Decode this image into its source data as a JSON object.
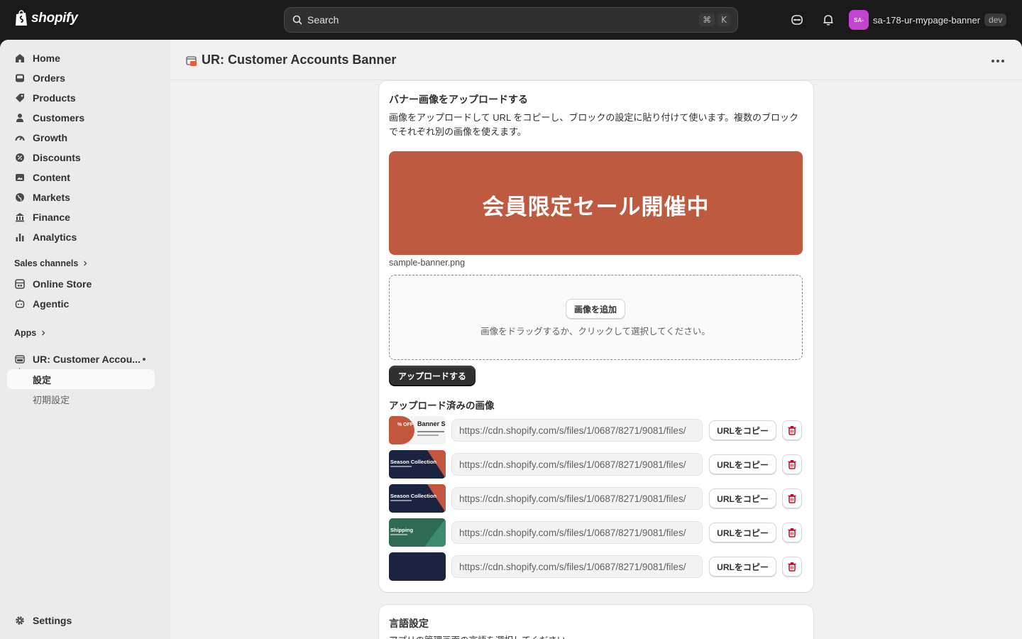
{
  "topbar": {
    "logo_text": "shopify",
    "search_placeholder": "Search",
    "search_shortcut_key1": "⌘",
    "search_shortcut_key2": "K",
    "store_initials": "SA-",
    "store_name": "sa-178-ur-mypage-banner",
    "store_badge": "dev"
  },
  "sidebar": {
    "nav": [
      {
        "label": "Home",
        "icon": "home-icon"
      },
      {
        "label": "Orders",
        "icon": "orders-icon"
      },
      {
        "label": "Products",
        "icon": "tag-icon"
      },
      {
        "label": "Customers",
        "icon": "person-icon"
      },
      {
        "label": "Growth",
        "icon": "gauge-icon"
      },
      {
        "label": "Discounts",
        "icon": "discount-icon"
      },
      {
        "label": "Content",
        "icon": "image-icon"
      },
      {
        "label": "Markets",
        "icon": "globe-icon"
      },
      {
        "label": "Finance",
        "icon": "bank-icon"
      },
      {
        "label": "Analytics",
        "icon": "bar-chart-icon"
      }
    ],
    "sales_channels_label": "Sales channels",
    "channels": [
      {
        "label": "Online Store",
        "icon": "store-icon"
      },
      {
        "label": "Agentic",
        "icon": "agentic-icon"
      }
    ],
    "apps_label": "Apps",
    "app_name": "UR: Customer Accou...",
    "app_sub_active": "設定",
    "app_sub_other": "初期設定",
    "settings_label": "Settings"
  },
  "page": {
    "title": "UR: Customer Accounts Banner"
  },
  "upload_card": {
    "title": "バナー画像をアップロードする",
    "description": "画像をアップロードして URL をコピーし、ブロックの設定に貼り付けて使います。複数のブロックでそれぞれ別の画像を使えます。",
    "banner_text": "会員限定セール開催中",
    "banner_color": "#bd5a40",
    "filename": "sample-banner.png",
    "add_button": "画像を追加",
    "drop_hint": "画像をドラッグするか、クリックして選択してください。",
    "upload_button": "アップロードする",
    "uploaded_title": "アップロード済みの画像",
    "copy_label": "URLをコピー",
    "images": [
      {
        "url": "https://cdn.shopify.com/s/files/1/0687/8271/9081/files/",
        "thumb_text": "Banner S",
        "thumb_badge": "% OFF"
      },
      {
        "url": "https://cdn.shopify.com/s/files/1/0687/8271/9081/files/",
        "thumb_text": "Season Collection"
      },
      {
        "url": "https://cdn.shopify.com/s/files/1/0687/8271/9081/files/",
        "thumb_text": "Season Collection"
      },
      {
        "url": "https://cdn.shopify.com/s/files/1/0687/8271/9081/files/",
        "thumb_text": "Shipping"
      },
      {
        "url": "https://cdn.shopify.com/s/files/1/0687/8271/9081/files/",
        "thumb_text": ""
      }
    ]
  },
  "language_card": {
    "title": "言語設定",
    "description": "アプリの管理画面の言語を選択してください。"
  }
}
